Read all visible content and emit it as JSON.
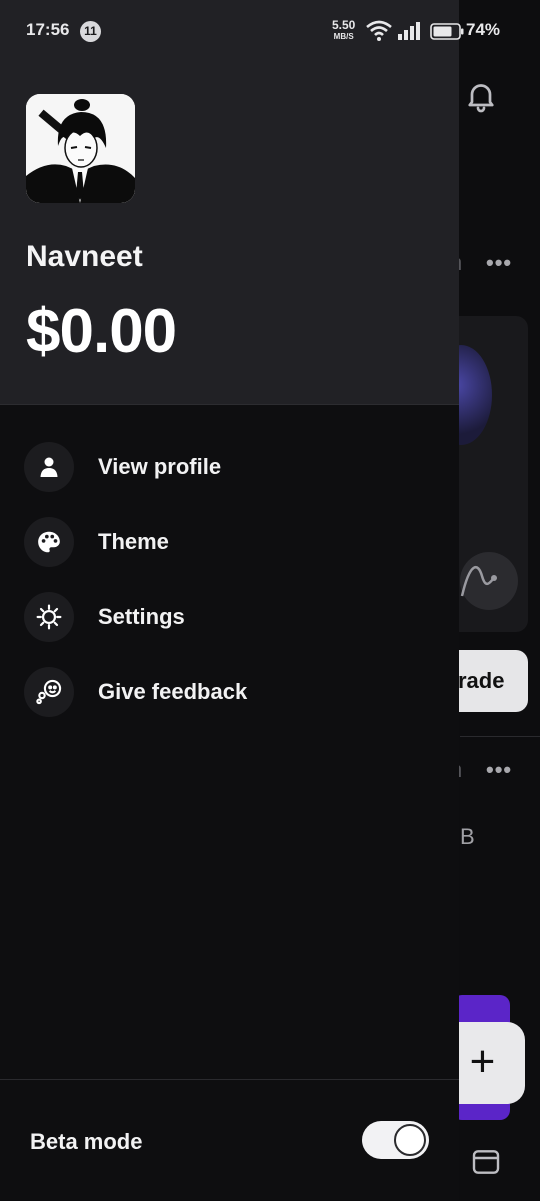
{
  "status_bar": {
    "time": "17:56",
    "notification_count": "11",
    "net_speed_value": "5.50",
    "net_speed_unit": "MB/S",
    "battery_percent": "74%"
  },
  "drawer": {
    "user_name": "Navneet",
    "balance": "$0.00",
    "menu": [
      {
        "label": "View profile",
        "icon": "person-icon"
      },
      {
        "label": "Theme",
        "icon": "palette-icon"
      },
      {
        "label": "Settings",
        "icon": "gear-icon"
      },
      {
        "label": "Give feedback",
        "icon": "feedback-icon"
      }
    ],
    "beta_mode": {
      "label": "Beta mode",
      "enabled": true
    }
  },
  "background": {
    "trade_button_fragment": "rade",
    "letter_fragment": "B",
    "fab_label": "+",
    "faded_fragment": "h"
  },
  "colors": {
    "drawer_bg": "#0e0e10",
    "header_bg": "#212125",
    "accent_purple": "#5b25c8"
  }
}
